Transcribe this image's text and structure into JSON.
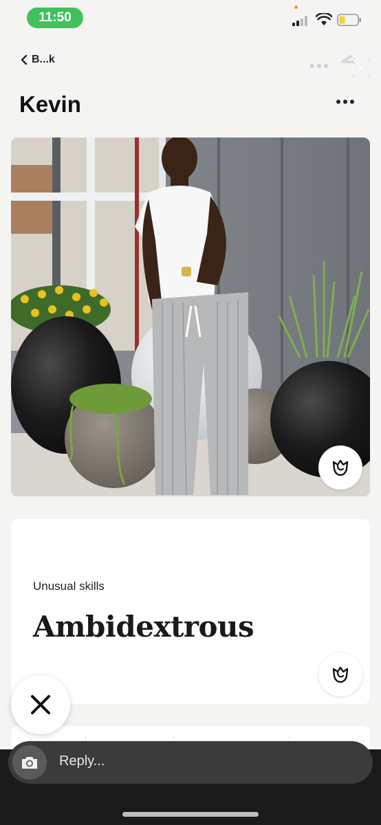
{
  "status": {
    "time": "11:50"
  },
  "nav": {
    "back_label": "B...k"
  },
  "profile": {
    "name": "Kevin"
  },
  "prompt": {
    "label": "Unusual skills",
    "answer": "Ambidextrous"
  },
  "reply": {
    "placeholder": "Reply..."
  },
  "colors": {
    "time_pill": "#3fc25b",
    "background": "#f4f4f2",
    "reply_bar": "#3b3b3b",
    "battery": "#f2d23a"
  },
  "icons": [
    "back-chevron-icon",
    "more-icon",
    "close-icon",
    "rose-icon",
    "skip-x-icon",
    "camera-icon",
    "wifi-icon",
    "signal-icon",
    "battery-icon"
  ]
}
